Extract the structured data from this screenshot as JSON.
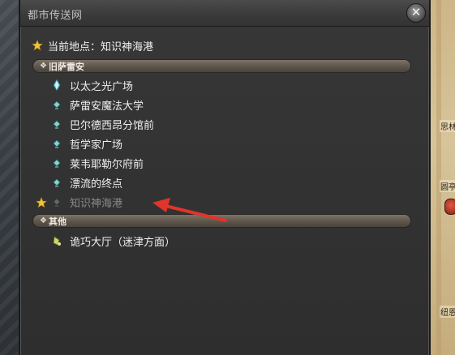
{
  "window": {
    "title": "都市传送网",
    "close_symbol": "✕"
  },
  "current_location": "当前地点：知识神海港",
  "groups": [
    {
      "name": "旧萨雷安",
      "items": [
        {
          "label": "以太之光广场",
          "icon": "aetheryte-crystal-icon",
          "disabled": false
        },
        {
          "label": "萨雷安魔法大学",
          "icon": "aethernet-shard-icon",
          "disabled": false
        },
        {
          "label": "巴尔德西昂分馆前",
          "icon": "aethernet-shard-icon",
          "disabled": false
        },
        {
          "label": "哲学家广场",
          "icon": "aethernet-shard-icon",
          "disabled": false
        },
        {
          "label": "莱韦耶勒尔府前",
          "icon": "aethernet-shard-icon",
          "disabled": false
        },
        {
          "label": "漂流的终点",
          "icon": "aethernet-shard-icon",
          "disabled": false
        },
        {
          "label": "知识神海港",
          "icon": "aethernet-shard-icon",
          "disabled": true,
          "favorite": true
        }
      ]
    },
    {
      "name": "其他",
      "items": [
        {
          "label": "诡巧大厅（迷津方面）",
          "icon": "residential-shard-icon",
          "disabled": false
        }
      ]
    }
  ],
  "map_labels": [
    "思林",
    "圆亭",
    "纽恩"
  ],
  "colors": {
    "accent_star": "#f2c23a",
    "arrow": "#e0352b",
    "shard": "#7fd6d2"
  }
}
